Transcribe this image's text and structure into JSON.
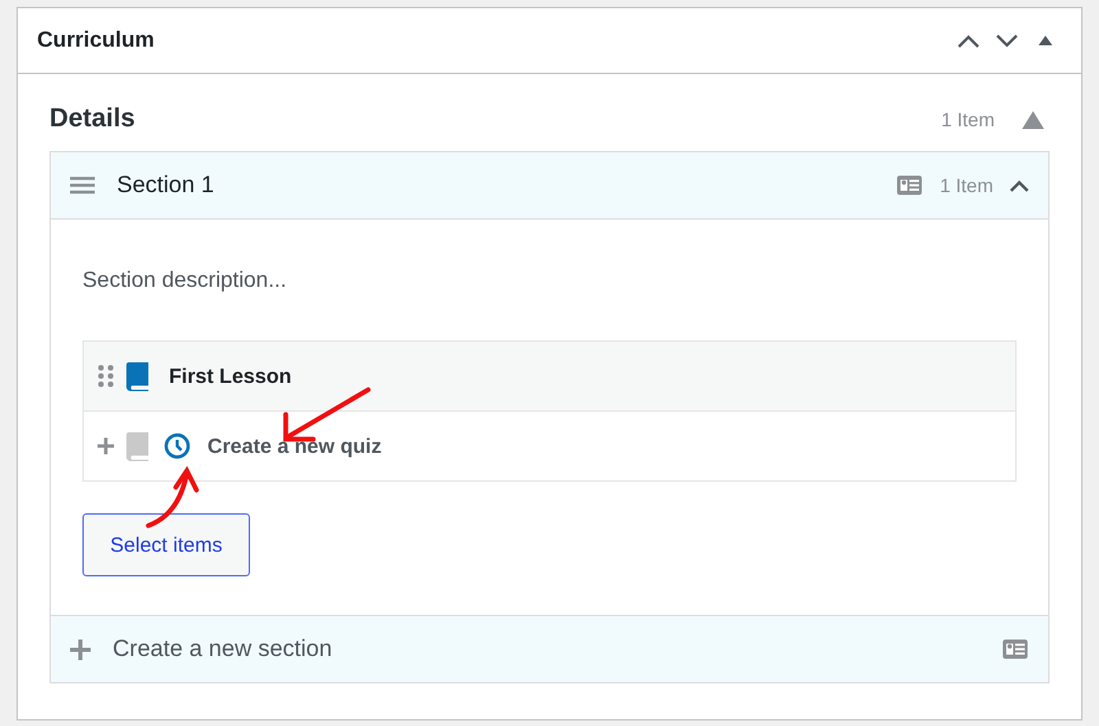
{
  "panel": {
    "title": "Curriculum"
  },
  "details": {
    "title": "Details",
    "count": "1 Item"
  },
  "section": {
    "title": "Section 1",
    "count": "1 Item",
    "expanded": true,
    "description": "Section description...",
    "items": [
      {
        "kind": "lesson",
        "title": "First Lesson"
      },
      {
        "kind": "new",
        "placeholder": "Create a new quiz"
      }
    ],
    "select_button": "Select items"
  },
  "new_section": {
    "placeholder": "Create a new section"
  }
}
